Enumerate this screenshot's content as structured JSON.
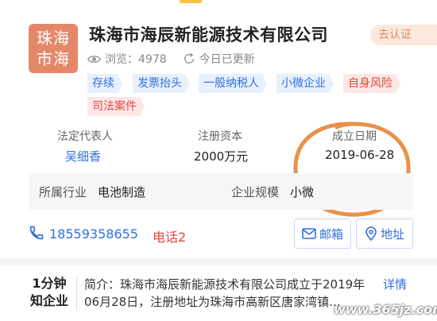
{
  "company": {
    "logo_text": "珠海市海",
    "name": "珠海市海辰新能源技术有限公司",
    "claim_label": "去认证",
    "views_label": "浏览：4978",
    "updated_label": "今日已更新"
  },
  "tags": [
    {
      "label": "存续"
    },
    {
      "label": "发票抬头"
    },
    {
      "label": "一般纳税人"
    },
    {
      "label": "小微企业"
    },
    {
      "label": "自身风险"
    },
    {
      "label": "司法案件"
    }
  ],
  "info": {
    "legal_rep_label": "法定代表人",
    "legal_rep_value": "吴细香",
    "capital_label": "注册资本",
    "capital_value": "2000万元",
    "founded_label": "成立日期",
    "founded_value": "2019-06-28"
  },
  "industry": {
    "industry_label": "所属行业",
    "industry_value": "电池制造",
    "scale_label": "企业规模",
    "scale_value": "小微"
  },
  "contact": {
    "phone": "18559358655",
    "phone_more": "电话2",
    "email_label": "邮箱",
    "address_label": "地址"
  },
  "bottom": {
    "brand_line1": "1分钟",
    "brand_line2": "知企业",
    "intro": "简介：珠海市海辰新能源技术有限公司成立于2019年06月28日，注册地址为珠海市高新区唐家湾镇...",
    "detail_label": "详情",
    "watermark": "www.365jz.com"
  },
  "colors": {
    "accent_blue": "#2f6fe0",
    "accent_red": "#e0463c",
    "logo_bg": "#e5886a",
    "annotation_circle": "#e8924a"
  }
}
